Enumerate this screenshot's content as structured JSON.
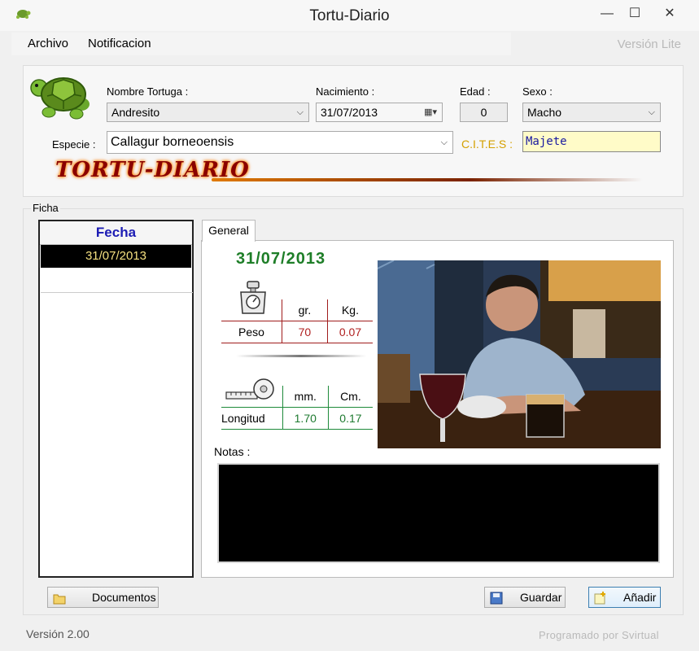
{
  "window": {
    "title": "Tortu-Diario",
    "minimize": "—",
    "maximize": "☐",
    "close": "✕"
  },
  "menu": {
    "items": [
      "Archivo",
      "Notificacion"
    ],
    "edition": "Versión Lite"
  },
  "header": {
    "nombre_label": "Nombre Tortuga :",
    "nombre_value": "Andresito",
    "nacimiento_label": "Nacimiento :",
    "nacimiento_value": "31/07/2013",
    "edad_label": "Edad :",
    "edad_value": "0",
    "sexo_label": "Sexo :",
    "sexo_value": "Macho",
    "especie_label": "Especie :",
    "especie_value": "Callagur borneoensis",
    "cites_label": "C.I.T.E.S :",
    "cites_value": "Majete",
    "logo": "TORTU-DIARIO"
  },
  "ficha": {
    "label": "Ficha",
    "list_header": "Fecha",
    "dates": [
      "31/07/2013"
    ],
    "tab": "General",
    "record_date": "31/07/2013",
    "peso": {
      "label": "Peso",
      "col1": "gr.",
      "col2": "Kg.",
      "v1": "70",
      "v2": "0.07"
    },
    "longitud": {
      "label": "Longitud",
      "col1": "mm.",
      "col2": "Cm.",
      "v1": "1.70",
      "v2": "0.17"
    },
    "notas_label": "Notas :"
  },
  "buttons": {
    "documentos": "Documentos",
    "guardar": "Guardar",
    "anadir": "Añadir"
  },
  "footer": {
    "version": "Versión 2.00",
    "credit": "Programado por Svirtual"
  },
  "colors": {
    "peso_line": "#a01c1c",
    "longitud_line": "#1e8a3a",
    "date_green": "#1e7e28",
    "header_blue": "#1c1cb4"
  }
}
